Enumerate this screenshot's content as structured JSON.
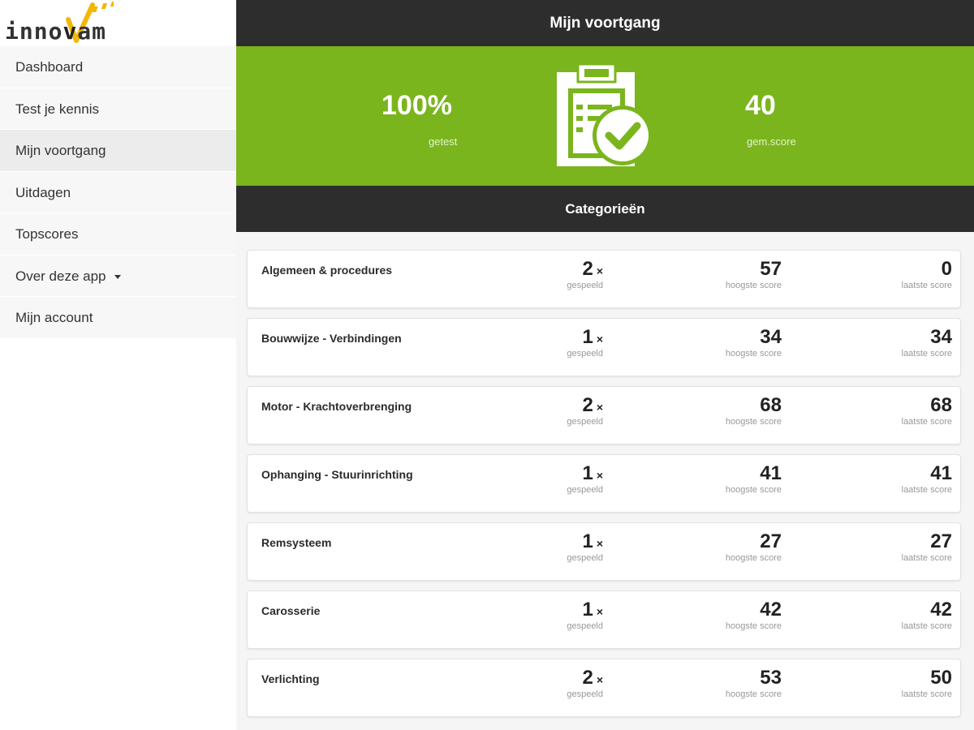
{
  "app": {
    "logo_text_pre": "inno",
    "logo_text_post": "am",
    "page_title": "Mijn voortgang"
  },
  "sidebar": {
    "items": [
      {
        "label": "Dashboard"
      },
      {
        "label": "Test je kennis"
      },
      {
        "label": "Mijn voortgang",
        "active": true
      },
      {
        "label": "Uitdagen"
      },
      {
        "label": "Topscores"
      },
      {
        "label": "Over deze app",
        "has_dropdown": true
      },
      {
        "label": "Mijn account"
      }
    ]
  },
  "summary": {
    "tested_value": "100%",
    "tested_label": "getest",
    "score_value": "40",
    "score_label": "gem.score",
    "icon": "clipboard-check-icon",
    "accent_color": "#7ab51d"
  },
  "categories_header": "Categorieën",
  "categories": [
    {
      "name": "Algemeen & procedures",
      "played": "2",
      "played_suffix": "×",
      "played_label": "gespeeld",
      "best": "57",
      "best_label": "hoogste score",
      "last": "0",
      "last_label": "laatste score"
    },
    {
      "name": "Bouwwijze - Verbindingen",
      "played": "1",
      "played_suffix": "×",
      "played_label": "gespeeld",
      "best": "34",
      "best_label": "hoogste score",
      "last": "34",
      "last_label": "laatste score"
    },
    {
      "name": "Motor - Krachtoverbrenging",
      "played": "2",
      "played_suffix": "×",
      "played_label": "gespeeld",
      "best": "68",
      "best_label": "hoogste score",
      "last": "68",
      "last_label": "laatste score"
    },
    {
      "name": "Ophanging - Stuurinrichting",
      "played": "1",
      "played_suffix": "×",
      "played_label": "gespeeld",
      "best": "41",
      "best_label": "hoogste score",
      "last": "41",
      "last_label": "laatste score"
    },
    {
      "name": "Remsysteem",
      "played": "1",
      "played_suffix": "×",
      "played_label": "gespeeld",
      "best": "27",
      "best_label": "hoogste score",
      "last": "27",
      "last_label": "laatste score"
    },
    {
      "name": "Carosserie",
      "played": "1",
      "played_suffix": "×",
      "played_label": "gespeeld",
      "best": "42",
      "best_label": "hoogste score",
      "last": "42",
      "last_label": "laatste score"
    },
    {
      "name": "Verlichting",
      "played": "2",
      "played_suffix": "×",
      "played_label": "gespeeld",
      "best": "53",
      "best_label": "hoogste score",
      "last": "50",
      "last_label": "laatste score"
    }
  ]
}
